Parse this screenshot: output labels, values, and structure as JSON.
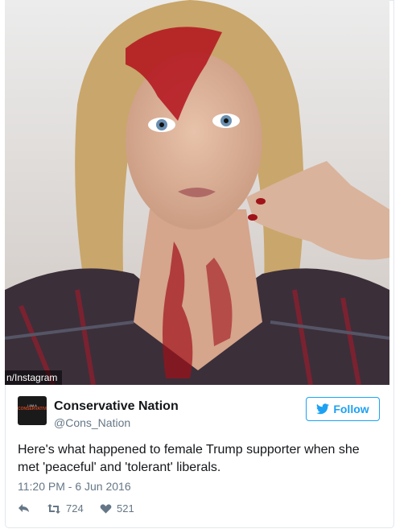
{
  "photo": {
    "credit": "n/Instagram"
  },
  "tweet": {
    "display_name": "Conservative Nation",
    "handle": "@Cons_Nation",
    "follow_label": "Follow",
    "text": "Here's what happened to female Trump supporter when she met 'peaceful' and 'tolerant' liberals.",
    "timestamp": "11:20 PM - 6 Jun 2016",
    "retweet_count": "724",
    "like_count": "521"
  },
  "avatar": {
    "line1": "I AM A",
    "line2": "CONSERVATIVE"
  },
  "icons": {
    "reply": "reply-icon",
    "retweet": "retweet-icon",
    "like": "heart-icon",
    "twitter_bird": "twitter-bird-icon"
  },
  "colors": {
    "accent": "#1da1f2",
    "text": "#14171a",
    "muted": "#657786",
    "border": "#e1e8ed"
  }
}
